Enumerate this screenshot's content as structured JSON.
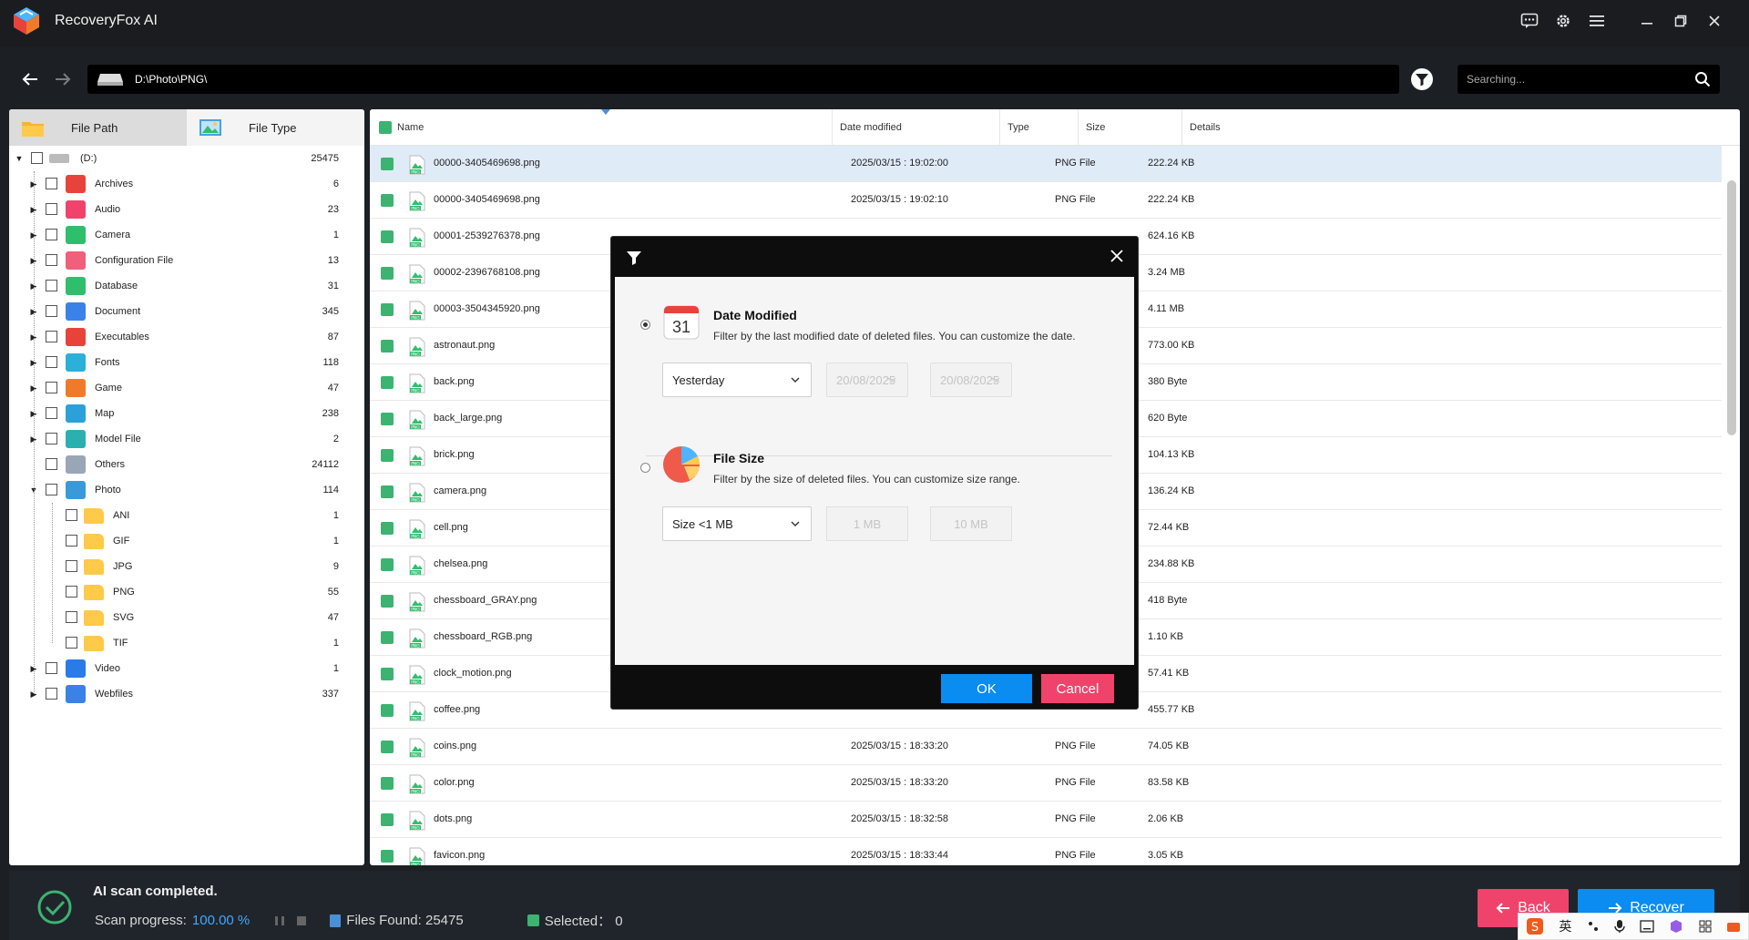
{
  "app": {
    "title": "RecoveryFox AI",
    "accent": "#0a8cf0",
    "danger": "#f0436c",
    "success": "#3cb371"
  },
  "titlebar_icons": [
    "chat-icon",
    "gear-icon",
    "menu-icon",
    "minimize-icon",
    "maximize-icon",
    "close-icon"
  ],
  "address": {
    "path": "D:\\Photo\\PNG\\",
    "search_placeholder": "Searching..."
  },
  "left_tabs": [
    {
      "label": "File Path",
      "active": true
    },
    {
      "label": "File Type",
      "active": false
    }
  ],
  "tree": {
    "root": {
      "label": "(D:)",
      "count": "25475"
    },
    "categories": [
      {
        "label": "Archives",
        "count": "6",
        "color": "#e8433b"
      },
      {
        "label": "Audio",
        "count": "23",
        "color": "#f0436c"
      },
      {
        "label": "Camera",
        "count": "1",
        "color": "#2fbf6c"
      },
      {
        "label": "Configuration File",
        "count": "13",
        "color": "#f0607a"
      },
      {
        "label": "Database",
        "count": "31",
        "color": "#2fbf6c"
      },
      {
        "label": "Document",
        "count": "345",
        "color": "#3a82e8"
      },
      {
        "label": "Executables",
        "count": "87",
        "color": "#e8433b"
      },
      {
        "label": "Fonts",
        "count": "118",
        "color": "#2bb0d9"
      },
      {
        "label": "Game",
        "count": "47",
        "color": "#f07a2a"
      },
      {
        "label": "Map",
        "count": "238",
        "color": "#2ba0d9"
      },
      {
        "label": "Model File",
        "count": "2",
        "color": "#2bb0b0"
      },
      {
        "label": "Others",
        "count": "24112",
        "color": "#9aa5b5"
      },
      {
        "label": "Photo",
        "count": "114",
        "color": "#3a9ad9"
      }
    ],
    "photo_children": [
      {
        "label": "ANI",
        "count": "1"
      },
      {
        "label": "GIF",
        "count": "1"
      },
      {
        "label": "JPG",
        "count": "9"
      },
      {
        "label": "PNG",
        "count": "55"
      },
      {
        "label": "SVG",
        "count": "47"
      },
      {
        "label": "TIF",
        "count": "1"
      }
    ],
    "tail": [
      {
        "label": "Video",
        "count": "1",
        "color": "#2a7ae8"
      },
      {
        "label": "Webfiles",
        "count": "337",
        "color": "#3a82e8"
      }
    ]
  },
  "list": {
    "headers": {
      "name": "Name",
      "date": "Date modified",
      "type": "Type",
      "size": "Size",
      "details": "Details"
    },
    "rows": [
      {
        "name": "00000-3405469698.png",
        "date": "2025/03/15 : 19:02:00",
        "type": "PNG File",
        "size": "222.24 KB",
        "selected": true
      },
      {
        "name": "00000-3405469698.png",
        "date": "2025/03/15 : 19:02:10",
        "type": "PNG File",
        "size": "222.24 KB"
      },
      {
        "name": "00001-2539276378.png",
        "date": "",
        "type": "",
        "size": "624.16 KB"
      },
      {
        "name": "00002-2396768108.png",
        "date": "",
        "type": "",
        "size": "3.24 MB"
      },
      {
        "name": "00003-3504345920.png",
        "date": "",
        "type": "",
        "size": "4.11 MB"
      },
      {
        "name": "astronaut.png",
        "date": "",
        "type": "",
        "size": "773.00 KB"
      },
      {
        "name": "back.png",
        "date": "",
        "type": "",
        "size": "380 Byte"
      },
      {
        "name": "back_large.png",
        "date": "",
        "type": "",
        "size": "620 Byte"
      },
      {
        "name": "brick.png",
        "date": "",
        "type": "",
        "size": "104.13 KB"
      },
      {
        "name": "camera.png",
        "date": "",
        "type": "",
        "size": "136.24 KB"
      },
      {
        "name": "cell.png",
        "date": "",
        "type": "",
        "size": "72.44 KB"
      },
      {
        "name": "chelsea.png",
        "date": "",
        "type": "",
        "size": "234.88 KB"
      },
      {
        "name": "chessboard_GRAY.png",
        "date": "",
        "type": "",
        "size": "418 Byte"
      },
      {
        "name": "chessboard_RGB.png",
        "date": "",
        "type": "",
        "size": "1.10 KB"
      },
      {
        "name": "clock_motion.png",
        "date": "",
        "type": "",
        "size": "57.41 KB"
      },
      {
        "name": "coffee.png",
        "date": "",
        "type": "",
        "size": "455.77 KB"
      },
      {
        "name": "coins.png",
        "date": "2025/03/15 : 18:33:20",
        "type": "PNG File",
        "size": "74.05 KB"
      },
      {
        "name": "color.png",
        "date": "2025/03/15 : 18:33:20",
        "type": "PNG File",
        "size": "83.58 KB"
      },
      {
        "name": "dots.png",
        "date": "2025/03/15 : 18:32:58",
        "type": "PNG File",
        "size": "2.06 KB"
      },
      {
        "name": "favicon.png",
        "date": "2025/03/15 : 18:33:44",
        "type": "PNG File",
        "size": "3.05 KB"
      }
    ]
  },
  "dialog": {
    "date": {
      "calendar_day": "31",
      "title": "Date Modified",
      "desc": "Filter by the last modified date of deleted files. You can customize the date.",
      "preset": "Yesterday",
      "from": "20/08/2025",
      "to": "20/08/2025"
    },
    "size": {
      "title": "File Size",
      "desc": "Filter by the size of deleted files. You can customize size range.",
      "preset": "Size <1 MB",
      "min": "1 MB",
      "max": "10 MB"
    },
    "ok_label": "OK",
    "cancel_label": "Cancel"
  },
  "status": {
    "title": "AI scan completed.",
    "progress_label": "Scan progress:",
    "progress_value": "100.00 %",
    "files_found": "Files Found: 25475",
    "selected": "Selected： 0",
    "back_label": "Back",
    "recover_label": "Recover"
  },
  "ime": {
    "lang": "英"
  }
}
